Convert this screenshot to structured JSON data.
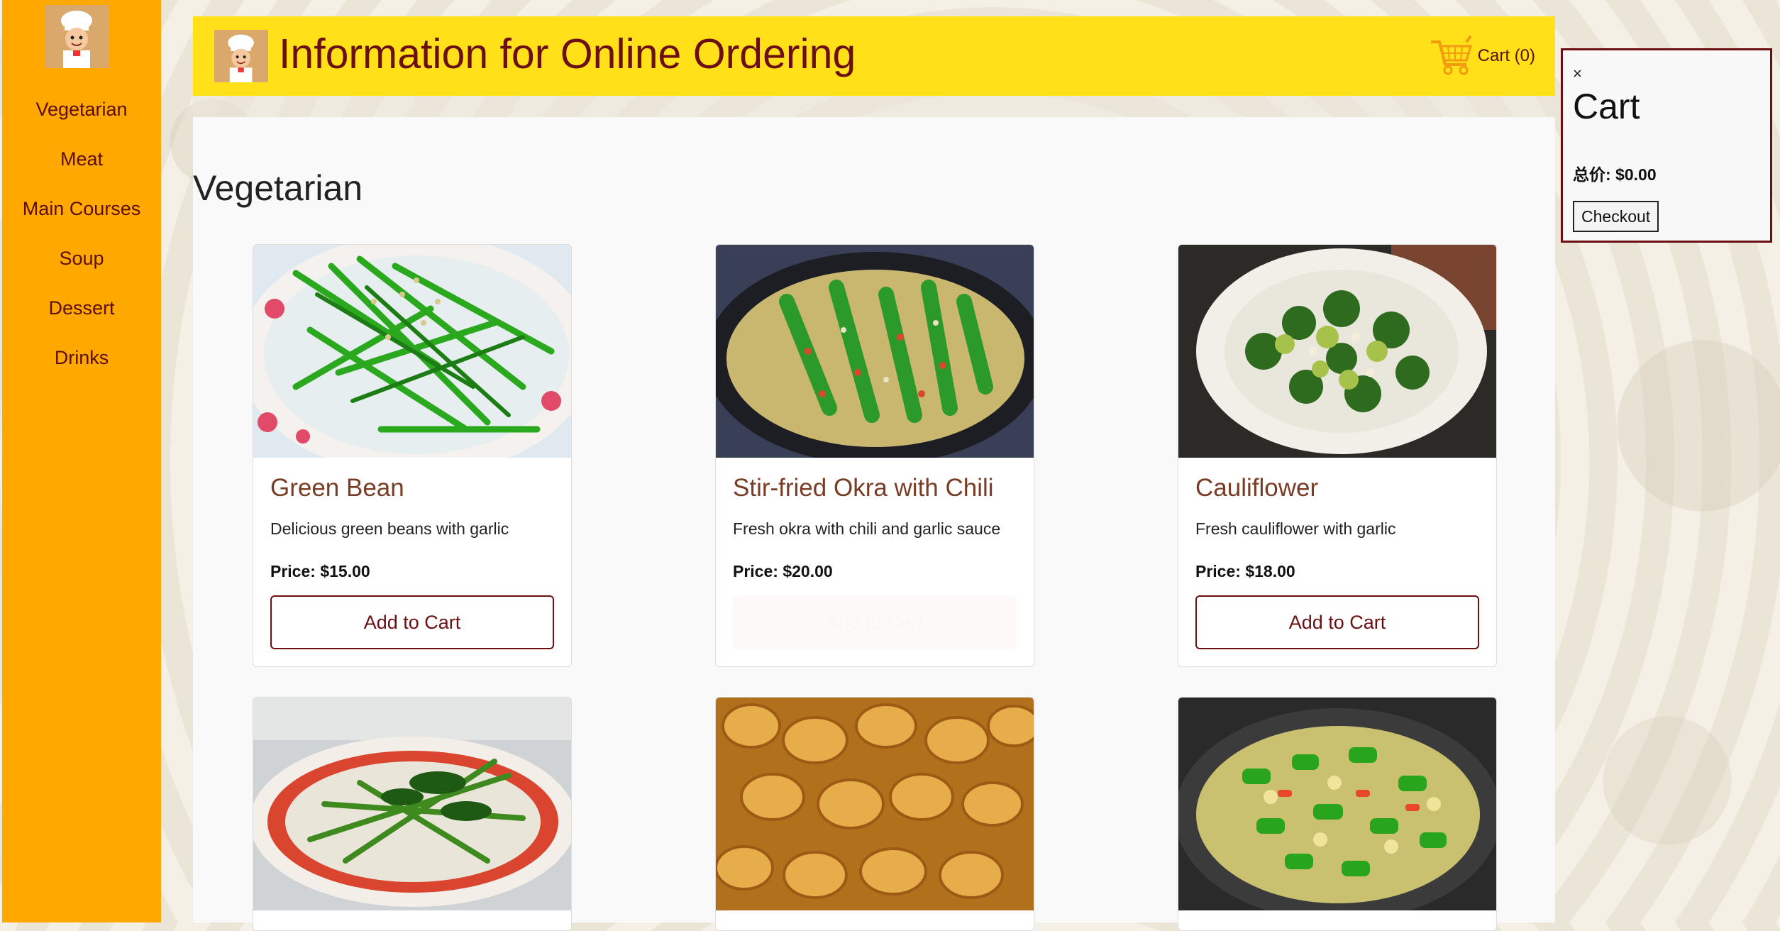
{
  "sidebar": {
    "items": [
      {
        "label": "Vegetarian"
      },
      {
        "label": "Meat"
      },
      {
        "label": "Main Courses"
      },
      {
        "label": "Soup"
      },
      {
        "label": "Dessert"
      },
      {
        "label": "Drinks"
      }
    ]
  },
  "header": {
    "title": "Information for Online Ordering",
    "cart_label": "Cart (0)"
  },
  "main": {
    "section_title": "Vegetarian",
    "cards": [
      {
        "name": "Green Bean",
        "desc": "Delicious green beans with garlic",
        "price": "Price: $15.00",
        "button": "Add to Cart"
      },
      {
        "name": "Stir-fried Okra with Chili",
        "desc": "Fresh okra with chili and garlic sauce",
        "price": "Price: $20.00",
        "button": "Add to Cart"
      },
      {
        "name": "Cauliflower",
        "desc": "Fresh cauliflower with garlic",
        "price": "Price: $18.00",
        "button": "Add to Cart"
      }
    ]
  },
  "cart_panel": {
    "close": "×",
    "title": "Cart",
    "total": "总价: $0.00",
    "checkout": "Checkout"
  }
}
